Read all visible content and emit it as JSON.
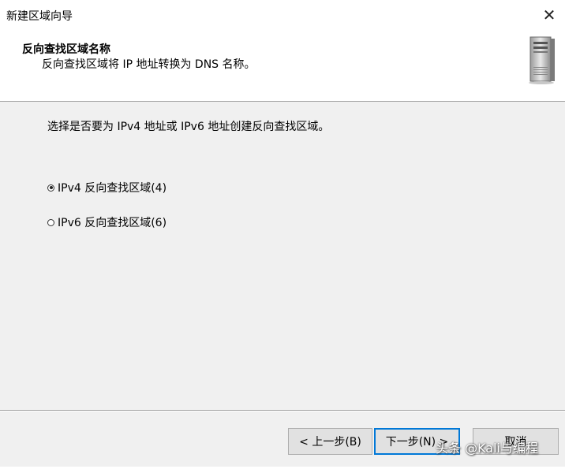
{
  "window": {
    "title": "新建区域向导",
    "close_glyph": "✕"
  },
  "header": {
    "title": "反向查找区域名称",
    "subtitle": "反向查找区域将 IP 地址转换为 DNS 名称。",
    "icon": "server-tower-icon"
  },
  "content": {
    "description": "选择是否要为 IPv4 地址或 IPv6 地址创建反向查找区域。",
    "options": [
      {
        "label": "IPv4 反向查找区域(4)",
        "checked": true
      },
      {
        "label": "IPv6 反向查找区域(6)",
        "checked": false
      }
    ]
  },
  "buttons": {
    "back": "< 上一步(B)",
    "next": "下一步(N) >",
    "cancel": "取消"
  },
  "watermark": "头条 @Kali与编程",
  "colors": {
    "focus_border": "#0078d7",
    "button_bg": "#e1e1e1",
    "dialog_bg": "#f0f0f0"
  }
}
